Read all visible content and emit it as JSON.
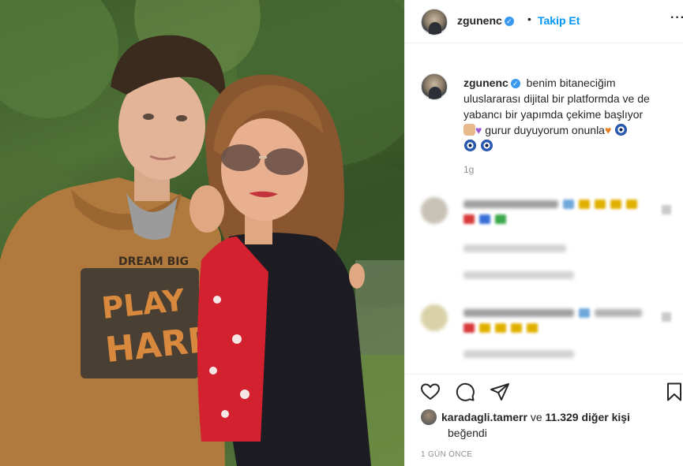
{
  "post": {
    "username": "zgunenc",
    "verified_badge": "✓",
    "separator": "•",
    "follow_label": "Takip Et",
    "more_label": "···",
    "caption": {
      "line1": "benim bitaneciğim",
      "line2": "uluslararası dijital bir platformda ve de",
      "line3": "yabancı bir yapımda çekime başlıyor",
      "line4": "gurur duyuyorum onunla",
      "time": "1g"
    },
    "likes": {
      "liker": "karadagli.tamerr",
      "conjunction": "ve",
      "count_text": "11.329 diğer kişi",
      "suffix": "beğendi"
    },
    "posted_ago": "1 GÜN ÖNCE"
  },
  "icons": {
    "like": "heart-outline-icon",
    "comment": "comment-bubble-icon",
    "share": "paper-plane-icon",
    "save": "bookmark-icon"
  },
  "colors": {
    "link_blue": "#0095f6",
    "verified_blue": "#3897f0",
    "muted_gray": "#8e8e8e",
    "border": "#efefef"
  },
  "photo": {
    "shirt_text_1": "DREAM BIG",
    "shirt_text_2": "PLAY",
    "shirt_text_3": "HARD"
  }
}
